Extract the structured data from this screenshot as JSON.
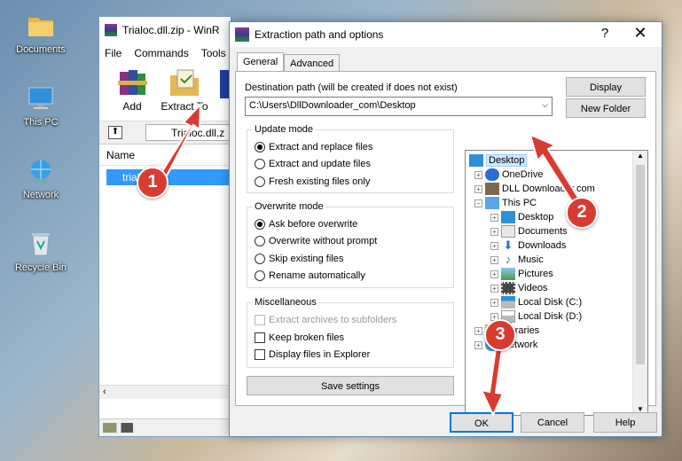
{
  "desktop": {
    "icons": [
      {
        "label": "Documents"
      },
      {
        "label": "This PC"
      },
      {
        "label": "Network"
      },
      {
        "label": "Recycle Bin"
      }
    ]
  },
  "winrar": {
    "title": "Trialoc.dll.zip - WinR",
    "menu": [
      "File",
      "Commands",
      "Tools"
    ],
    "toolbar": {
      "add": "Add",
      "extract_to": "Extract To"
    },
    "path": "Trialoc.dll.z",
    "column_name": "Name",
    "selected_file": "trial"
  },
  "dialog": {
    "title": "Extraction path and options",
    "help_glyph": "?",
    "close_glyph": "✕",
    "tabs": [
      "General",
      "Advanced"
    ],
    "destination_label": "Destination path (will be created if does not exist)",
    "destination_value": "C:\\Users\\DllDownloader_com\\Desktop",
    "display_button": "Display",
    "new_folder_button": "New Folder",
    "update_mode": {
      "title": "Update mode",
      "options": [
        "Extract and replace files",
        "Extract and update files",
        "Fresh existing files only"
      ],
      "selected": 0
    },
    "overwrite_mode": {
      "title": "Overwrite mode",
      "options": [
        "Ask before overwrite",
        "Overwrite without prompt",
        "Skip existing files",
        "Rename automatically"
      ],
      "selected": 0
    },
    "misc": {
      "title": "Miscellaneous",
      "options": [
        "Extract archives to subfolders",
        "Keep broken files",
        "Display files in Explorer"
      ]
    },
    "save_settings": "Save settings",
    "tree": [
      "Desktop",
      "OneDrive",
      "DLL Downloader.com",
      "This PC",
      "Desktop",
      "Documents",
      "Downloads",
      "Music",
      "Pictures",
      "Videos",
      "Local Disk (C:)",
      "Local Disk (D:)",
      "Libraries",
      "Network"
    ],
    "ok": "OK",
    "cancel": "Cancel",
    "help": "Help"
  },
  "callouts": [
    "1",
    "2",
    "3"
  ],
  "colors": {
    "callout": "#d83b30",
    "selection": "#3399ff",
    "tree_selection": "#cce8ff"
  }
}
